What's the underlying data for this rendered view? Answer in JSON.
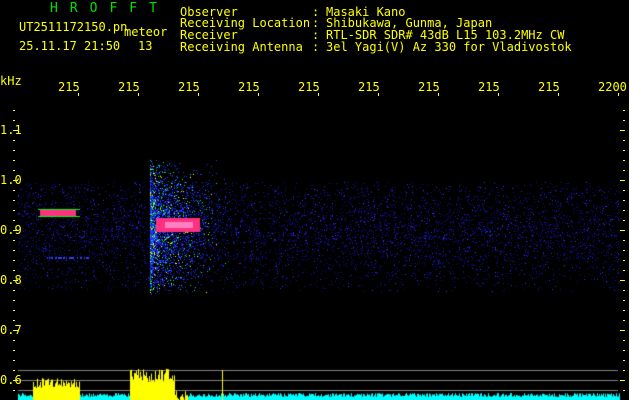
{
  "header": {
    "app_title": "HROFFT",
    "file_name": "UT2511172150.pn",
    "mode": "meteor",
    "datetime": "25.11.17 21:50",
    "count": "13"
  },
  "info": [
    {
      "label": "Observer",
      "value": "Masaki Kano"
    },
    {
      "label": "Receiving Location",
      "value": "Shibukawa, Gunma, Japan"
    },
    {
      "label": "Receiver",
      "value": "RTL-SDR SDR# 43dB L15 103.2MHz CW"
    },
    {
      "label": "Receiving Antenna",
      "value": "3el Yagi(V) Az 330 for Vladivostok"
    }
  ],
  "axes": {
    "y_unit": "kHz",
    "x_ticks": [
      "2151",
      "2152",
      "2153",
      "2154",
      "2155",
      "2156",
      "2157",
      "2158",
      "2159",
      "2200"
    ],
    "y_ticks": [
      "1.1",
      "1.0",
      "0.9",
      "0.8",
      "0.7",
      "0.6"
    ]
  },
  "colors": {
    "text": "#ffff00",
    "title": "#00e000",
    "signal": "#ffff00",
    "noise": "#00ffff",
    "threshold": "#808080"
  }
}
